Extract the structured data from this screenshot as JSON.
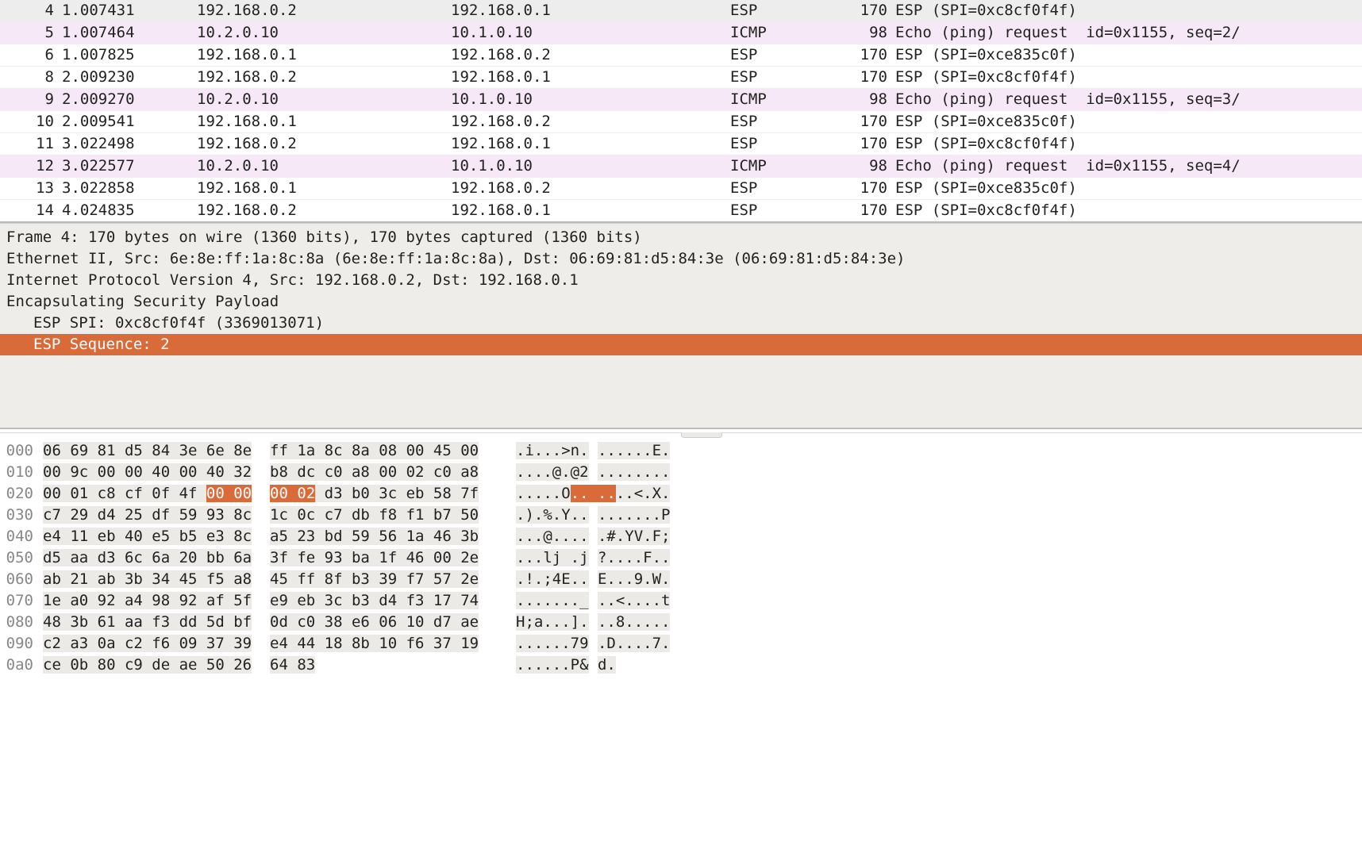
{
  "packets": [
    {
      "num": "4",
      "time": "1.007431",
      "src": "192.168.0.2",
      "dst": "192.168.0.1",
      "proto": "ESP",
      "len": "170",
      "info": "ESP (SPI=0xc8cf0f4f)",
      "cls": "sel first"
    },
    {
      "num": "5",
      "time": "1.007464",
      "src": "10.2.0.10",
      "dst": "10.1.0.10",
      "proto": "ICMP",
      "len": "98",
      "info": "Echo (ping) request  id=0x1155, seq=2/",
      "cls": "icmp"
    },
    {
      "num": "6",
      "time": "1.007825",
      "src": "192.168.0.1",
      "dst": "192.168.0.2",
      "proto": "ESP",
      "len": "170",
      "info": "ESP (SPI=0xce835c0f)",
      "cls": "esp"
    },
    {
      "num": "8",
      "time": "2.009230",
      "src": "192.168.0.2",
      "dst": "192.168.0.1",
      "proto": "ESP",
      "len": "170",
      "info": "ESP (SPI=0xc8cf0f4f)",
      "cls": "esp"
    },
    {
      "num": "9",
      "time": "2.009270",
      "src": "10.2.0.10",
      "dst": "10.1.0.10",
      "proto": "ICMP",
      "len": "98",
      "info": "Echo (ping) request  id=0x1155, seq=3/",
      "cls": "icmp"
    },
    {
      "num": "10",
      "time": "2.009541",
      "src": "192.168.0.1",
      "dst": "192.168.0.2",
      "proto": "ESP",
      "len": "170",
      "info": "ESP (SPI=0xce835c0f)",
      "cls": "esp"
    },
    {
      "num": "11",
      "time": "3.022498",
      "src": "192.168.0.2",
      "dst": "192.168.0.1",
      "proto": "ESP",
      "len": "170",
      "info": "ESP (SPI=0xc8cf0f4f)",
      "cls": "esp"
    },
    {
      "num": "12",
      "time": "3.022577",
      "src": "10.2.0.10",
      "dst": "10.1.0.10",
      "proto": "ICMP",
      "len": "98",
      "info": "Echo (ping) request  id=0x1155, seq=4/",
      "cls": "icmp"
    },
    {
      "num": "13",
      "time": "3.022858",
      "src": "192.168.0.1",
      "dst": "192.168.0.2",
      "proto": "ESP",
      "len": "170",
      "info": "ESP (SPI=0xce835c0f)",
      "cls": "esp"
    },
    {
      "num": "14",
      "time": "4.024835",
      "src": "192.168.0.2",
      "dst": "192.168.0.1",
      "proto": "ESP",
      "len": "170",
      "info": "ESP (SPI=0xc8cf0f4f)",
      "cls": "esp"
    }
  ],
  "details": {
    "frame": "Frame 4: 170 bytes on wire (1360 bits), 170 bytes captured (1360 bits)",
    "eth": "Ethernet II, Src: 6e:8e:ff:1a:8c:8a (6e:8e:ff:1a:8c:8a), Dst: 06:69:81:d5:84:3e (06:69:81:d5:84:3e)",
    "ip": "Internet Protocol Version 4, Src: 192.168.0.2, Dst: 192.168.0.1",
    "esp": "Encapsulating Security Payload",
    "spi": "ESP SPI: 0xc8cf0f4f (3369013071)",
    "seq": "ESP Sequence: 2"
  },
  "hex": [
    {
      "off": "000",
      "b1": "06 69 81 d5 84 3e 6e 8e",
      "b2": "ff 1a 8c 8a 08 00 45 00",
      "a1": ".i...>n.",
      "a2": "......E."
    },
    {
      "off": "010",
      "b1": "00 9c 00 00 40 00 40 32",
      "b2": "b8 dc c0 a8 00 02 c0 a8",
      "a1": "....@.@2",
      "a2": "........"
    },
    {
      "off": "020",
      "b1": "00 01 c8 cf 0f 4f ",
      "hl1": "00 00",
      "gap": "  ",
      "hl2": "00 02",
      "b2": " d3 b0 3c eb 58 7f",
      "a1": ".....O",
      "ah": ".. ..",
      "a2": "..<.X.",
      "hlrow": true
    },
    {
      "off": "030",
      "b1": "c7 29 d4 25 df 59 93 8c",
      "b2": "1c 0c c7 db f8 f1 b7 50",
      "a1": ".).%.Y..",
      "a2": ".......P"
    },
    {
      "off": "040",
      "b1": "e4 11 eb 40 e5 b5 e3 8c",
      "b2": "a5 23 bd 59 56 1a 46 3b",
      "a1": "...@....",
      "a2": ".#.YV.F;"
    },
    {
      "off": "050",
      "b1": "d5 aa d3 6c 6a 20 bb 6a",
      "b2": "3f fe 93 ba 1f 46 00 2e",
      "a1": "...lj .j",
      "a2": "?....F.."
    },
    {
      "off": "060",
      "b1": "ab 21 ab 3b 34 45 f5 a8",
      "b2": "45 ff 8f b3 39 f7 57 2e",
      "a1": ".!.;4E..",
      "a2": "E...9.W."
    },
    {
      "off": "070",
      "b1": "1e a0 92 a4 98 92 af 5f",
      "b2": "e9 eb 3c b3 d4 f3 17 74",
      "a1": "......._",
      "a2": "..<....t"
    },
    {
      "off": "080",
      "b1": "48 3b 61 aa f3 dd 5d bf",
      "b2": "0d c0 38 e6 06 10 d7 ae",
      "a1": "H;a...].",
      "a2": "..8....."
    },
    {
      "off": "090",
      "b1": "c2 a3 0a c2 f6 09 37 39",
      "b2": "e4 44 18 8b 10 f6 37 19",
      "a1": "......79",
      "a2": ".D....7."
    },
    {
      "off": "0a0",
      "b1": "ce 0b 80 c9 de ae 50 26",
      "b2": "64 83",
      "a1": "......P&",
      "a2": "d."
    }
  ]
}
